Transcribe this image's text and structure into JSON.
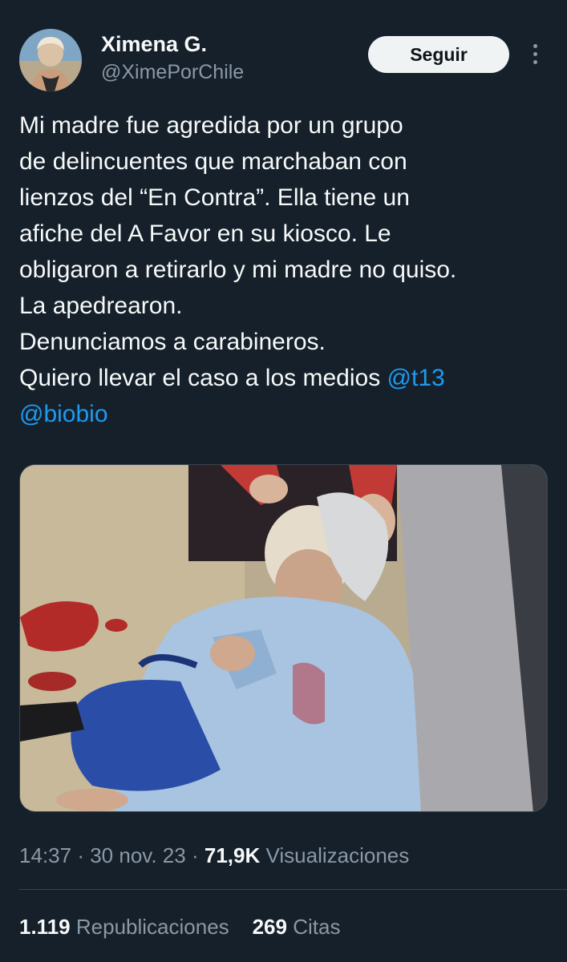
{
  "author": {
    "display_name": "Ximena G.",
    "handle": "@XimePorChile",
    "avatar_icon": "profile-photo"
  },
  "follow_label": "Seguir",
  "tweet": {
    "lines": [
      "Mi madre fue agredida por un grupo",
      "de delincuentes que marchaban con",
      "lienzos del “En Contra”. Ella tiene un",
      "afiche del A Favor en su kiosco. Le",
      "obligaron a retirarlo y mi madre no quiso.",
      "La apedrearon.",
      "Denunciamos a carabineros.",
      "Quiero llevar el caso a los medios "
    ],
    "mentions": [
      "@t13",
      "@biobio"
    ]
  },
  "media": {
    "type": "photo"
  },
  "meta": {
    "time": "14:37",
    "separator": "·",
    "date": "30 nov. 23",
    "views_count": "71,9K",
    "views_label": "Visualizaciones"
  },
  "stats": {
    "reposts_count": "1.119",
    "reposts_label": "Republicaciones",
    "quotes_count": "269",
    "quotes_label": "Citas"
  },
  "colors": {
    "background": "#15202b",
    "text": "#f7f9f9",
    "secondary": "#8b98a5",
    "link": "#1d9bf0",
    "divider": "#38444d",
    "button_bg": "#eff3f4"
  }
}
